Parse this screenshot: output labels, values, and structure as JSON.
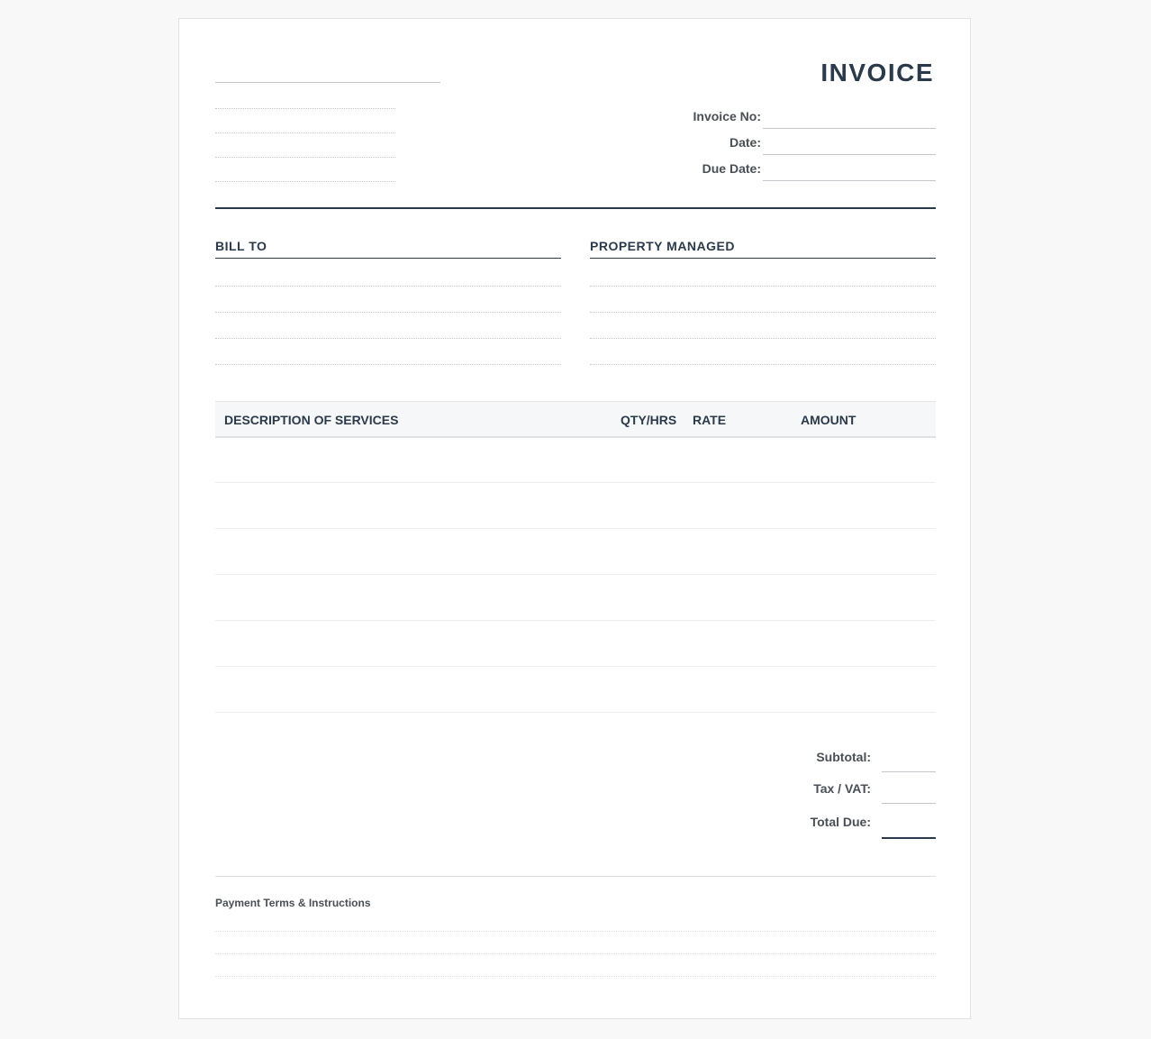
{
  "header": {
    "title": "INVOICE",
    "fields": [
      {
        "label": "Invoice No:",
        "value": ""
      },
      {
        "label": "Date:",
        "value": ""
      },
      {
        "label": "Due Date:",
        "value": ""
      }
    ]
  },
  "bill_to": {
    "heading": "BILL TO",
    "lines": [
      "",
      "",
      "",
      ""
    ]
  },
  "property": {
    "heading": "PROPERTY MANAGED",
    "lines": [
      "",
      "",
      "",
      ""
    ]
  },
  "table": {
    "columns": [
      "DESCRIPTION OF SERVICES",
      "QTY/HRS",
      "RATE",
      "AMOUNT"
    ],
    "rows": [
      [
        "",
        "",
        "",
        ""
      ],
      [
        "",
        "",
        "",
        ""
      ],
      [
        "",
        "",
        "",
        ""
      ],
      [
        "",
        "",
        "",
        ""
      ],
      [
        "",
        "",
        "",
        ""
      ],
      [
        "",
        "",
        "",
        ""
      ]
    ]
  },
  "totals": {
    "subtotal_label": "Subtotal:",
    "tax_label": "Tax / VAT:",
    "total_label": "Total Due:"
  },
  "terms": {
    "label": "Payment Terms & Instructions"
  }
}
